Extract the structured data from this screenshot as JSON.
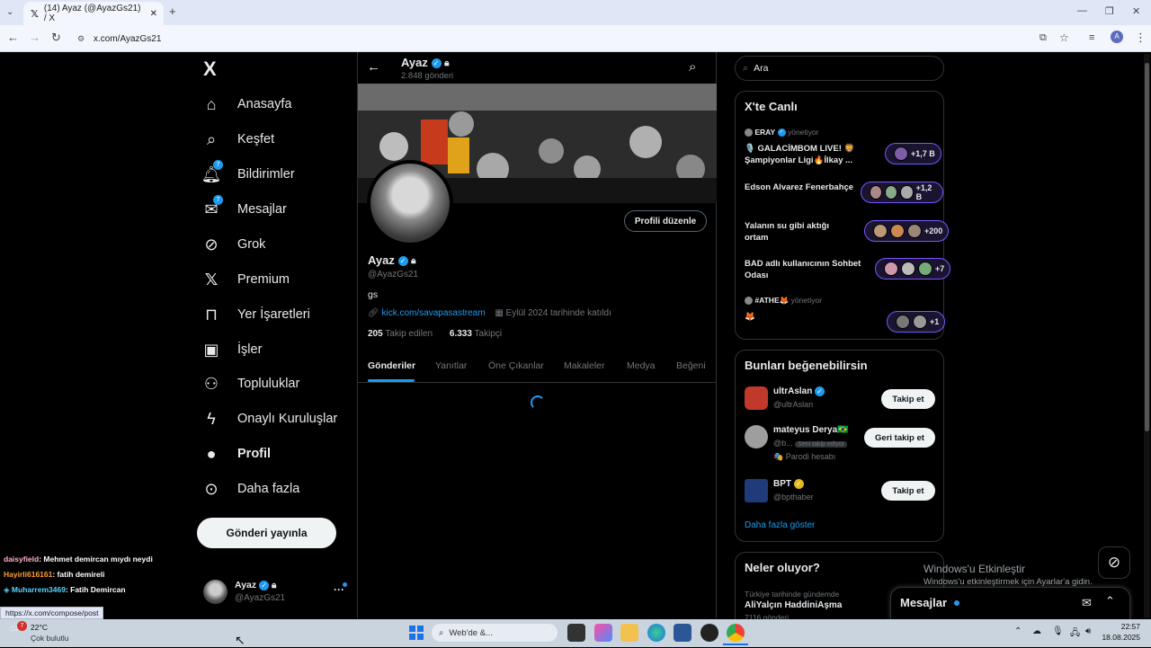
{
  "browser": {
    "tab_title": "(14) Ayaz (@AyazGs21) / X",
    "url": "x.com/AyazGs21",
    "status_url": "https://x.com/compose/post",
    "avatar_letter": "A"
  },
  "nav": {
    "logo": "X",
    "items": [
      {
        "label": "Anasayfa",
        "icon": "home-icon"
      },
      {
        "label": "Keşfet",
        "icon": "search-icon"
      },
      {
        "label": "Bildirimler",
        "icon": "bell-icon",
        "badge": "7"
      },
      {
        "label": "Mesajlar",
        "icon": "mail-icon",
        "badge": "7"
      },
      {
        "label": "Grok",
        "icon": "grok-icon"
      },
      {
        "label": "Premium",
        "icon": "x-icon"
      },
      {
        "label": "Yer İşaretleri",
        "icon": "bookmark-icon"
      },
      {
        "label": "İşler",
        "icon": "briefcase-icon"
      },
      {
        "label": "Topluluklar",
        "icon": "communities-icon"
      },
      {
        "label": "Onaylı Kuruluşlar",
        "icon": "lightning-icon"
      },
      {
        "label": "Profil",
        "icon": "person-icon"
      },
      {
        "label": "Daha fazla",
        "icon": "more-circle-icon"
      }
    ],
    "post_button": "Gönderi yayınla",
    "account_name": "Ayaz",
    "account_handle": "@AyazGs21"
  },
  "header": {
    "name": "Ayaz",
    "posts": "2.848 gönderi"
  },
  "profile": {
    "edit_button": "Profili düzenle",
    "name": "Ayaz",
    "handle": "@AyazGs21",
    "bio": "gs",
    "link": "kick.com/savapasastream",
    "joined": "Eylül 2024 tarihinde katıldı",
    "following_count": "205",
    "following_label": "Takip edilen",
    "followers_count": "6.333",
    "followers_label": "Takipçi",
    "tabs": [
      "Gönderiler",
      "Yanıtlar",
      "Öne Çıkanlar",
      "Makaleler",
      "Medya",
      "Beğeni"
    ]
  },
  "search": {
    "placeholder": "Ara"
  },
  "live": {
    "title": "X'te Canlı",
    "host1": "ERAY",
    "hosting_label": "yönetiyor",
    "spaces": [
      {
        "title": "🎙️ GALACİMBOM LIVE! 🦁 Şampiyonlar Ligi🔥İlkay ...",
        "count": "+1,7 B"
      },
      {
        "title": "Edson Alvarez Fenerbahçe",
        "count": "+1,2 B"
      },
      {
        "title": "Yalanın su gibi aktığı ortam",
        "count": "+200"
      },
      {
        "title": "BAD adlı kullanıcının Sohbet Odası",
        "count": "+7"
      },
      {
        "title": "🦊",
        "count": "+1"
      }
    ],
    "host2": "#ATHE🦊"
  },
  "suggest": {
    "title": "Bunları beğenebilirsin",
    "users": [
      {
        "name": "ultrAslan",
        "handle": "@ultrAslan",
        "button": "Takip et"
      },
      {
        "name": "mateyus Derya🇧🇷",
        "handle": "@b...",
        "tag": "Seni takip ediyor",
        "note": "🎭 Parodi hesabı",
        "button": "Geri takip et"
      },
      {
        "name": "BPT",
        "handle": "@bpthaber",
        "button": "Takip et"
      }
    ],
    "more": "Daha fazla göster"
  },
  "trends": {
    "title": "Neler oluyor?",
    "context": "Türkiye tarihinde gündemde",
    "topic": "AliYalçın HaddiniAşma",
    "count": "7116 gönderi"
  },
  "messages": {
    "label": "Mesajlar"
  },
  "watermark": {
    "line1": "Windows'u Etkinleştir",
    "line2": "Windows'u etkinleştirmek için Ayarlar'a gidin."
  },
  "chat": [
    {
      "user": "daisyfield",
      "text": ": Mehmet demircan mıydı neydi",
      "color": "#ffb3c8"
    },
    {
      "user": "Hayirli616161",
      "text": ": fatih demireli",
      "color": "#ffa033"
    },
    {
      "user": "Muharrem3469",
      "text": ": Fatih Demircan",
      "color": "#5ad3ff"
    }
  ],
  "taskbar": {
    "weather_temp": "22°C",
    "weather_text": "Çok bulutlu",
    "weather_badge": "7",
    "search_text": "Web'de &...",
    "time": "22:57",
    "date": "18.08.2025"
  }
}
